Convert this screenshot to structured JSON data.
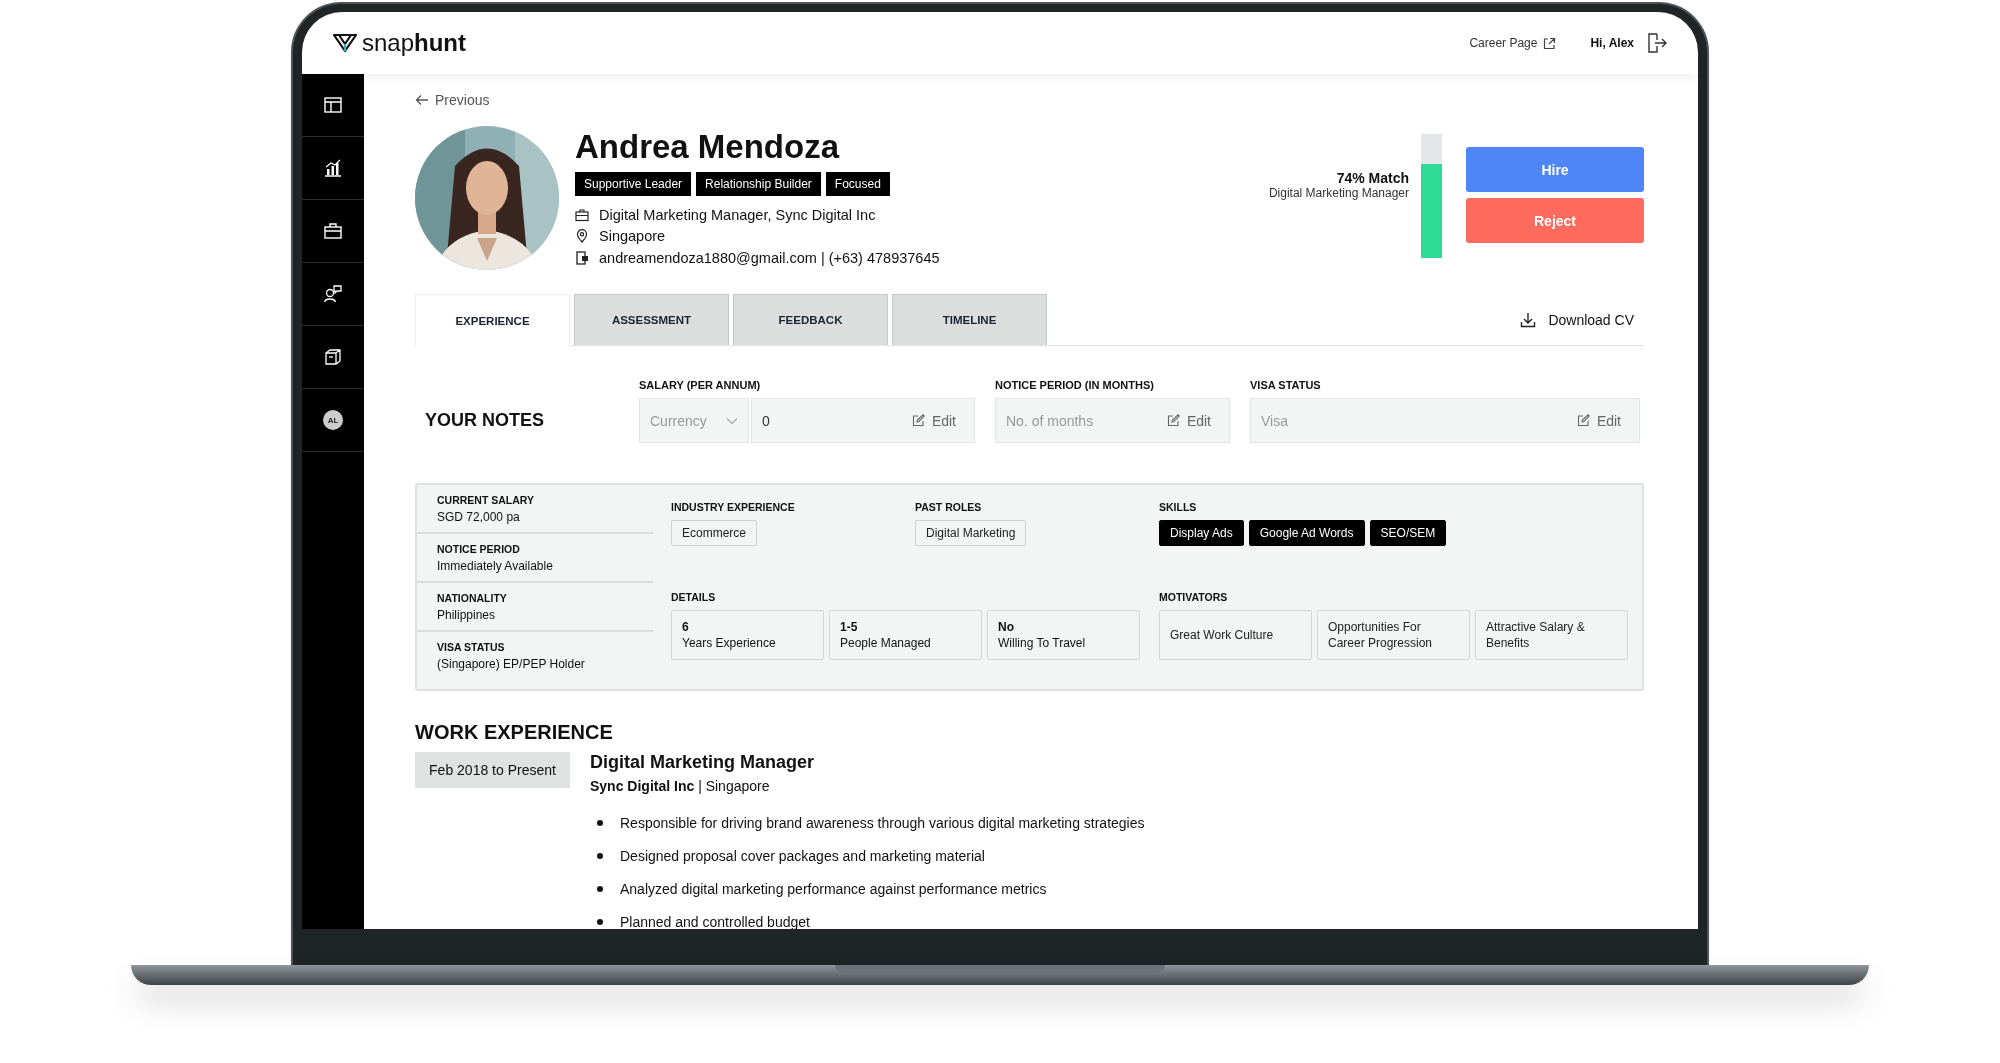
{
  "header": {
    "logo": "snap**hunt**",
    "career_link": "Career Page",
    "greeting": "Hi, Alex"
  },
  "sidebar": {
    "avatar_initials": "AL"
  },
  "back_link": "Previous",
  "candidate": {
    "name": "Andrea Mendoza",
    "tags": [
      "Supportive Leader",
      "Relationship Builder",
      "Focused"
    ],
    "role": "Digital Marketing Manager, Sync Digital Inc",
    "location": "Singapore",
    "contact": "andreamendoza1880@gmail.com | (+63) 478937645"
  },
  "match": {
    "label": "74% Match",
    "job": "Digital Marketing Manager",
    "level": 0.74
  },
  "actions": [
    {
      "kind": "hire",
      "label": "Hire"
    },
    {
      "kind": "reject",
      "label": "Reject"
    }
  ],
  "tabs": [
    {
      "label": "EXPERIENCE",
      "selected": true
    },
    {
      "label": "ASSESSMENT",
      "selected": false
    },
    {
      "label": "FEEDBACK",
      "selected": false
    },
    {
      "label": "TIMELINE",
      "selected": false
    }
  ],
  "download": "Download CV",
  "notes": {
    "title": "YOUR NOTES",
    "fields": [
      {
        "kind": "salary",
        "label": "SALARY (PER ANNUM)",
        "currency_placeholder": "Currency",
        "value": "0",
        "edit": "Edit"
      },
      {
        "kind": "plain",
        "label": "NOTICE PERIOD (IN MONTHS)",
        "placeholder": "No. of months",
        "edit": "Edit"
      },
      {
        "kind": "plain",
        "label": "VISA STATUS",
        "placeholder": "Visa",
        "edit": "Edit"
      }
    ]
  },
  "summary": {
    "facts": [
      {
        "label": "CURRENT SALARY",
        "value": "SGD 72,000 pa"
      },
      {
        "label": "NOTICE PERIOD",
        "value": "Immediately Available"
      },
      {
        "label": "NATIONALITY",
        "value": "Philippines"
      },
      {
        "label": "VISA STATUS",
        "value": "(Singapore) EP/PEP Holder"
      }
    ],
    "tag_groups": [
      {
        "label": "INDUSTRY EXPERIENCE",
        "kind": "outlined",
        "tags": [
          "Ecommerce"
        ]
      },
      {
        "label": "PAST ROLES",
        "kind": "outlined",
        "tags": [
          "Digital Marketing"
        ]
      },
      {
        "label": "SKILLS",
        "kind": "filled",
        "tags": [
          "Display Ads",
          "Google Ad Words",
          "SEO/SEM"
        ]
      }
    ],
    "details": {
      "label": "DETAILS",
      "items": [
        {
          "value": "6",
          "caption": "Years Experience"
        },
        {
          "value": "1-5",
          "caption": "People Managed"
        },
        {
          "value": "No",
          "caption": "Willing To Travel"
        }
      ]
    },
    "motivators": {
      "label": "MOTIVATORS",
      "items": [
        "Great Work Culture",
        "Opportunities For Career Progression",
        "Attractive Salary & Benefits"
      ]
    }
  },
  "work_experience": {
    "title": "WORK EXPERIENCE",
    "jobs": [
      {
        "period": "Feb 2018 to Present",
        "title": "Digital Marketing Manager",
        "company_line": "**Sync Digital Inc** | Singapore",
        "bullets": [
          "Responsible for driving brand awareness through various digital marketing strategies",
          "Designed proposal cover packages and marketing material",
          "Analyzed digital marketing performance against performance metrics",
          "Planned and controlled budget"
        ]
      }
    ]
  }
}
